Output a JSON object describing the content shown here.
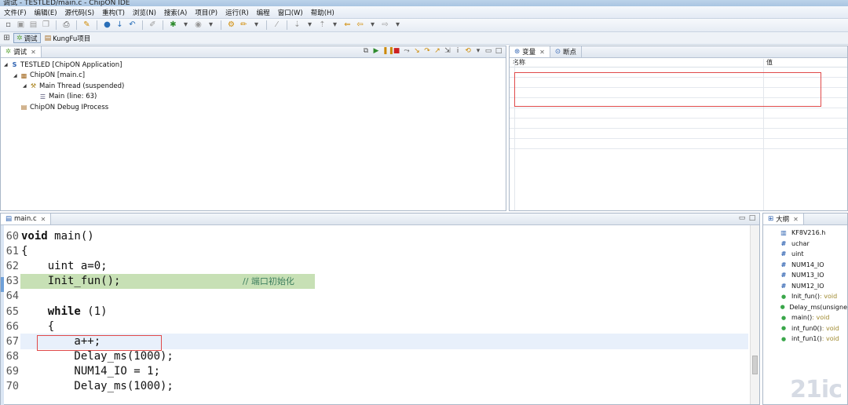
{
  "window": {
    "title": "调试 - TESTLED/main.c - ChipON IDE"
  },
  "menu": [
    "文件(F)",
    "编辑(E)",
    "源代码(S)",
    "重构(T)",
    "浏览(N)",
    "搜索(A)",
    "项目(P)",
    "运行(R)",
    "编程",
    "窗口(W)",
    "帮助(H)"
  ],
  "perspectives": [
    {
      "label": "调试",
      "active": true,
      "icon": "debug-bug-icon"
    },
    {
      "label": "KungFu项目",
      "active": false,
      "icon": "kungfu-project-icon"
    }
  ],
  "debug_view": {
    "tab": "调试",
    "tree": [
      {
        "label": "TESTLED [ChipON Application]",
        "level": 0,
        "icon": "launch-icon"
      },
      {
        "label": "ChipON [main.c]",
        "level": 1,
        "icon": "chipon-target-icon"
      },
      {
        "label": "Main Thread (suspended)",
        "level": 2,
        "icon": "thread-icon"
      },
      {
        "label": "Main (line: 63)",
        "level": 3,
        "icon": "stack-frame-icon"
      },
      {
        "label": "ChipON Debug IProcess",
        "level": 1,
        "icon": "process-icon"
      }
    ]
  },
  "variables_view": {
    "tabs": [
      "变量",
      "断点"
    ],
    "columns": [
      "名称",
      "值"
    ]
  },
  "editor": {
    "tab": "main.c",
    "current_line": 63,
    "cursor_line": 67,
    "lines": [
      {
        "n": "60",
        "code": "void main()"
      },
      {
        "n": "61",
        "code": "{"
      },
      {
        "n": "62",
        "code": "    uint a=0;"
      },
      {
        "n": "63",
        "code": "    Init_fun();",
        "comment": "// 端口初始化"
      },
      {
        "n": "64",
        "code": ""
      },
      {
        "n": "65",
        "code": "    while (1)"
      },
      {
        "n": "66",
        "code": "    {"
      },
      {
        "n": "67",
        "code": "        a++;"
      },
      {
        "n": "68",
        "code": "        Delay_ms(1000);"
      },
      {
        "n": "69",
        "code": "        NUM14_IO = 1;"
      },
      {
        "n": "70",
        "code": "        Delay_ms(1000);"
      }
    ]
  },
  "outline_view": {
    "tab": "大纲",
    "items": [
      {
        "label": "KF8V216.h",
        "type": "",
        "icon": "include-icon"
      },
      {
        "label": "uchar",
        "type": "",
        "icon": "hash-icon"
      },
      {
        "label": "uint",
        "type": "",
        "icon": "hash-icon"
      },
      {
        "label": "NUM14_IO",
        "type": "",
        "icon": "hash-icon"
      },
      {
        "label": "NUM13_IO",
        "type": "",
        "icon": "hash-icon"
      },
      {
        "label": "NUM12_IO",
        "type": "",
        "icon": "hash-icon"
      },
      {
        "label": "Init_fun()",
        "type": " : void",
        "icon": "function-icon"
      },
      {
        "label": "Delay_ms(unsigne",
        "type": "",
        "icon": "function-icon"
      },
      {
        "label": "main()",
        "type": " : void",
        "icon": "function-icon"
      },
      {
        "label": "int_fun0()",
        "type": " : void",
        "icon": "function-icon"
      },
      {
        "label": "int_fun1()",
        "type": " : void",
        "icon": "function-icon"
      }
    ]
  },
  "watermark": "21ic"
}
